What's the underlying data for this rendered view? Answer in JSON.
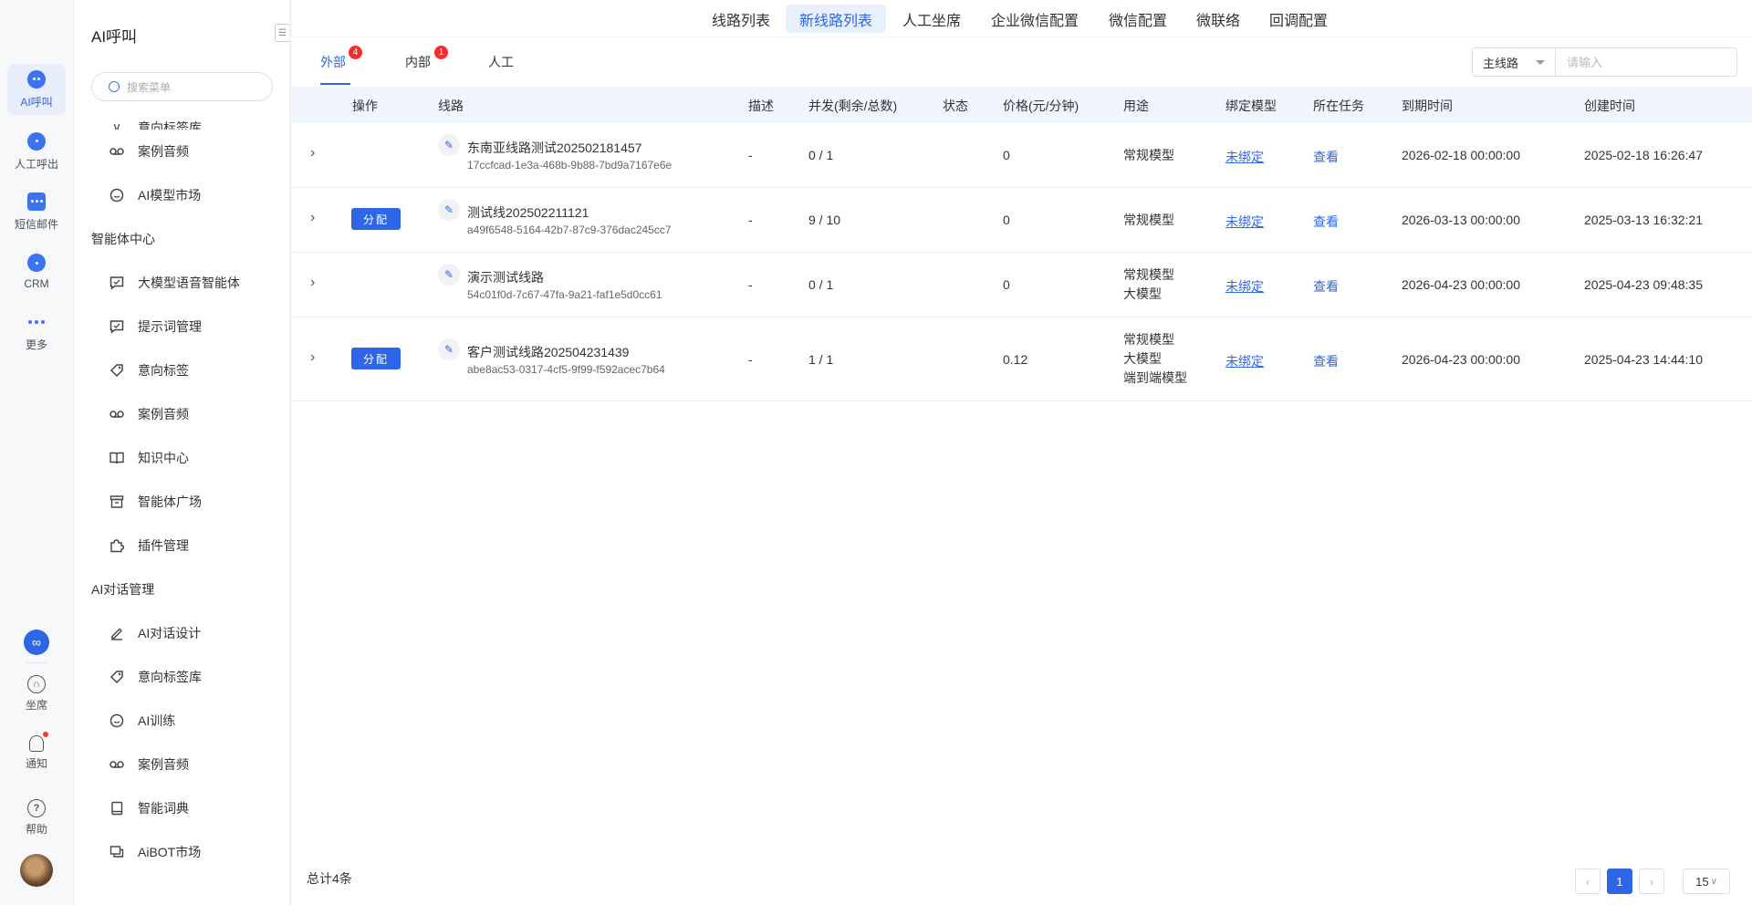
{
  "rail": {
    "items": [
      {
        "label": "AI呼叫",
        "icon": "ai-call-icon",
        "active": true
      },
      {
        "label": "人工呼出",
        "icon": "manual-call-icon"
      },
      {
        "label": "短信邮件",
        "icon": "sms-email-icon"
      },
      {
        "label": "CRM",
        "icon": "crm-icon"
      },
      {
        "label": "更多",
        "icon": "more-icon"
      }
    ],
    "bottom": [
      {
        "label": "坐席",
        "icon": "headset-icon"
      },
      {
        "label": "通知",
        "icon": "bell-icon"
      },
      {
        "label": "帮助",
        "icon": "help-icon"
      }
    ]
  },
  "menu": {
    "title": "AI呼叫",
    "search_placeholder": "搜索菜单",
    "partial_item": "意向标签库",
    "items_top": [
      {
        "label": "案例音频",
        "icon": "voicemail-icon"
      },
      {
        "label": "AI模型市场",
        "icon": "chat-bubble-icon"
      }
    ],
    "section1": "智能体中心",
    "items_s1": [
      {
        "label": "大模型语音智能体",
        "icon": "message-square-icon"
      },
      {
        "label": "提示词管理",
        "icon": "message-square-icon"
      },
      {
        "label": "意向标签",
        "icon": "tag-icon"
      },
      {
        "label": "案例音频",
        "icon": "voicemail-icon"
      },
      {
        "label": "知识中心",
        "icon": "book-open-icon"
      },
      {
        "label": "智能体广场",
        "icon": "archive-icon"
      },
      {
        "label": "插件管理",
        "icon": "puzzle-icon"
      }
    ],
    "section2": "AI对话管理",
    "items_s2": [
      {
        "label": "AI对话设计",
        "icon": "edit-icon"
      },
      {
        "label": "意向标签库",
        "icon": "tag-icon"
      },
      {
        "label": "AI训练",
        "icon": "chat-bubble-icon"
      },
      {
        "label": "案例音频",
        "icon": "voicemail-icon"
      },
      {
        "label": "智能词典",
        "icon": "book-icon"
      },
      {
        "label": "AiBOT市场",
        "icon": "messages-icon"
      }
    ]
  },
  "topnav": [
    "线路列表",
    "新线路列表",
    "人工坐席",
    "企业微信配置",
    "微信配置",
    "微联络",
    "回调配置"
  ],
  "topnav_active": "新线路列表",
  "subtabs": {
    "external": {
      "label": "外部",
      "count": "4"
    },
    "internal": {
      "label": "内部",
      "count": "1"
    },
    "manual": {
      "label": "人工"
    }
  },
  "filter": {
    "select_value": "主线路",
    "input_placeholder": "请输入"
  },
  "table": {
    "headers": {
      "op": "操作",
      "line": "线路",
      "desc": "描述",
      "conc": "并发(剩余/总数)",
      "status": "状态",
      "price": "价格(元/分钟)",
      "use": "用途",
      "model": "绑定模型",
      "task": "所在任务",
      "expire": "到期时间",
      "created": "创建时间"
    },
    "assign_label": "分配",
    "rows": [
      {
        "name": "东南亚线路测试202502181457",
        "id": "17ccfcad-1e3a-468b-9b88-7bd9a7167e6e",
        "assign": false,
        "desc": "-",
        "conc": "0 / 1",
        "status": "",
        "price": "0",
        "use1": "常规模型",
        "use2": "",
        "use3": "",
        "model": "未绑定",
        "task": "查看",
        "expire": "2026-02-18 00:00:00",
        "created": "2025-02-18 16:26:47"
      },
      {
        "name": "测试线202502211121",
        "id": "a49f6548-5164-42b7-87c9-376dac245cc7",
        "assign": true,
        "desc": "-",
        "conc": "9 / 10",
        "status": "",
        "price": "0",
        "use1": "常规模型",
        "use2": "",
        "use3": "",
        "model": "未绑定",
        "task": "查看",
        "expire": "2026-03-13 00:00:00",
        "created": "2025-03-13 16:32:21"
      },
      {
        "name": "演示测试线路",
        "id": "54c01f0d-7c67-47fa-9a21-faf1e5d0cc61",
        "assign": false,
        "desc": "-",
        "conc": "0 / 1",
        "status": "",
        "price": "0",
        "use1": "常规模型",
        "use2": "大模型",
        "use3": "",
        "model": "未绑定",
        "task": "查看",
        "expire": "2026-04-23 00:00:00",
        "created": "2025-04-23 09:48:35"
      },
      {
        "name": "客户测试线路202504231439",
        "id": "abe8ac53-0317-4cf5-9f99-f592acec7b64",
        "assign": true,
        "desc": "-",
        "conc": "1 / 1",
        "status": "",
        "price": "0.12",
        "use1": "常规模型",
        "use2": "大模型",
        "use3": "端到端模型",
        "model": "未绑定",
        "task": "查看",
        "expire": "2026-04-23 00:00:00",
        "created": "2025-04-23 14:44:10"
      }
    ]
  },
  "footer": {
    "total": "总计4条",
    "current_page": "1",
    "page_size": "15"
  },
  "colors": {
    "accent": "#2f66e8",
    "badge": "#f52d2d",
    "header_bg": "#f0f5fe"
  }
}
